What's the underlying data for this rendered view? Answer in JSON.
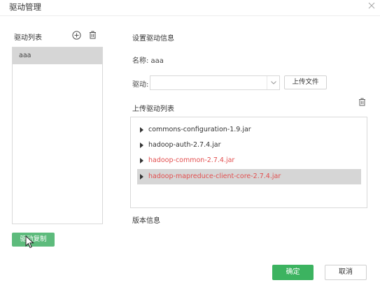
{
  "window": {
    "title": "驱动管理",
    "close_icon": "close-icon"
  },
  "left_panel": {
    "label": "驱动列表",
    "add_icon": "plus-circle-icon",
    "delete_icon": "trash-icon",
    "items": [
      {
        "label": "aaa",
        "selected": true
      }
    ],
    "copy_button_label": "驱动复制"
  },
  "right_panel": {
    "section_title": "设置驱动信息",
    "name_line": "名称: aaa",
    "driver_label": "驱动:",
    "driver_select": {
      "value": "",
      "caret_icon": "chevron-down-icon"
    },
    "upload_button_label": "上传文件",
    "upload_list_label": "上传驱动列表",
    "upload_list_delete_icon": "trash-icon",
    "jars": [
      {
        "name": "commons-configuration-1.9.jar",
        "highlight": false,
        "selected": false
      },
      {
        "name": "hadoop-auth-2.7.4.jar",
        "highlight": false,
        "selected": false
      },
      {
        "name": "hadoop-common-2.7.4.jar",
        "highlight": true,
        "selected": false
      },
      {
        "name": "hadoop-mapreduce-client-core-2.7.4.jar",
        "highlight": true,
        "selected": true
      }
    ],
    "version_label": "版本信息"
  },
  "footer": {
    "ok_label": "确定",
    "cancel_label": "取消"
  },
  "colors": {
    "accent_green": "#3cb360",
    "copy_button_green": "#5dbb7c",
    "highlight_red": "#e24f4f",
    "selection_gray": "#d6d6d6"
  }
}
